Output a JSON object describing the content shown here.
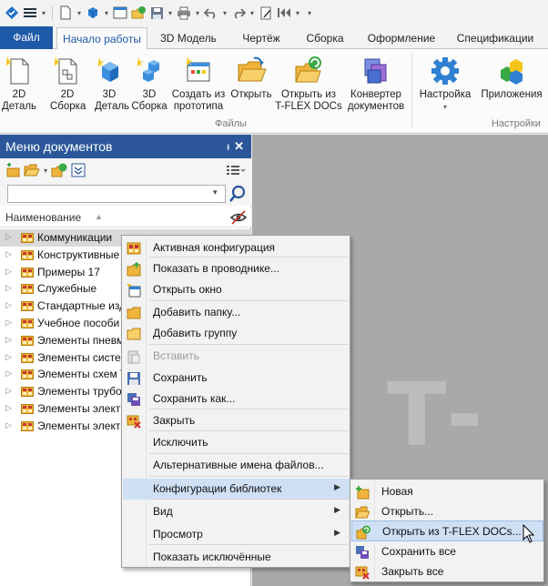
{
  "quick_access": {
    "icons": [
      "app-logo-icon",
      "hamburger-menu-icon",
      "new-document-icon",
      "new-3d-icon",
      "window-icon",
      "open-from-tflex-icon",
      "save-icon",
      "print-icon",
      "undo-icon",
      "redo-icon",
      "edit-icon",
      "rewind-icon",
      "customize-dropdown-icon"
    ]
  },
  "tabs": [
    {
      "label": "Файл"
    },
    {
      "label": "Начало работы"
    },
    {
      "label": "3D Модель"
    },
    {
      "label": "Чертёж"
    },
    {
      "label": "Сборка"
    },
    {
      "label": "Оформление"
    },
    {
      "label": "Спецификации"
    }
  ],
  "ribbon": {
    "buttons": [
      {
        "label": "2D\nДеталь",
        "icon": "2d-part-icon"
      },
      {
        "label": "2D\nСборка",
        "icon": "2d-assembly-icon"
      },
      {
        "label": "3D\nДеталь",
        "icon": "3d-part-icon"
      },
      {
        "label": "3D\nСборка",
        "icon": "3d-assembly-icon"
      },
      {
        "label": "Создать из\nпрототипа",
        "icon": "create-from-prototype-icon"
      },
      {
        "label": "Открыть",
        "icon": "open-folder-icon"
      },
      {
        "label": "Открыть из\nT-FLEX DOCs",
        "icon": "open-from-tflex-docs-icon"
      },
      {
        "label": "Конвертер\nдокументов",
        "icon": "document-converter-icon"
      },
      {
        "label": "Настройка",
        "icon": "settings-gear-icon"
      },
      {
        "label": "Приложения",
        "icon": "applications-icon"
      }
    ],
    "groups": {
      "files": "Файлы",
      "settings": "Настройки"
    }
  },
  "panel": {
    "title": "Меню документов",
    "pin_glyph": "ᵻ",
    "close_glyph": "✕",
    "search": {
      "value": "",
      "placeholder": ""
    },
    "column_header": "Наименование",
    "tree_items": [
      {
        "label": "Коммуникации"
      },
      {
        "label": "Конструктивные"
      },
      {
        "label": "Примеры 17"
      },
      {
        "label": "Служебные"
      },
      {
        "label": "Стандартные изд"
      },
      {
        "label": "Учебное пособи"
      },
      {
        "label": "Элементы пневм"
      },
      {
        "label": "Элементы систе"
      },
      {
        "label": "Элементы схем Т"
      },
      {
        "label": "Элементы трубо"
      },
      {
        "label": "Элементы элект"
      },
      {
        "label": "Элементы элект"
      }
    ]
  },
  "workspace": {
    "watermark": "T-FL"
  },
  "context_menu": {
    "items": [
      {
        "label": "Активная конфигурация",
        "icon": "active-config-icon"
      },
      {
        "label": "Показать в проводнике...",
        "icon": "show-in-explorer-icon"
      },
      {
        "label": "Открыть окно",
        "icon": "open-window-icon"
      },
      {
        "label": "Добавить папку...",
        "icon": "add-folder-icon"
      },
      {
        "label": "Добавить группу",
        "icon": "add-group-icon"
      },
      {
        "label": "Вставить",
        "icon": "paste-icon"
      },
      {
        "label": "Сохранить",
        "icon": "save-icon"
      },
      {
        "label": "Сохранить как...",
        "icon": "save-as-icon"
      },
      {
        "label": "Закрыть",
        "icon": "close-config-icon"
      },
      {
        "label": "Исключить",
        "icon": ""
      },
      {
        "label": "Альтернативные имена файлов...",
        "icon": ""
      },
      {
        "label": "Конфигурации библиотек",
        "icon": ""
      },
      {
        "label": "Вид",
        "icon": ""
      },
      {
        "label": "Просмотр",
        "icon": ""
      },
      {
        "label": "Показать исключённые",
        "icon": ""
      }
    ]
  },
  "submenu": {
    "items": [
      {
        "label": "Новая",
        "icon": "new-config-icon"
      },
      {
        "label": "Открыть...",
        "icon": "open-config-icon"
      },
      {
        "label": "Открыть из T-FLEX DOCs...",
        "icon": "open-from-tflex-docs-icon"
      },
      {
        "label": "Сохранить все",
        "icon": "save-all-icon"
      },
      {
        "label": "Закрыть все",
        "icon": "close-all-icon"
      }
    ]
  },
  "colors": {
    "file_tab": "#1e5aa8",
    "panel_title": "#2b579a",
    "highlight": "#cfe0f5",
    "workspace": "#a9a9a9"
  }
}
